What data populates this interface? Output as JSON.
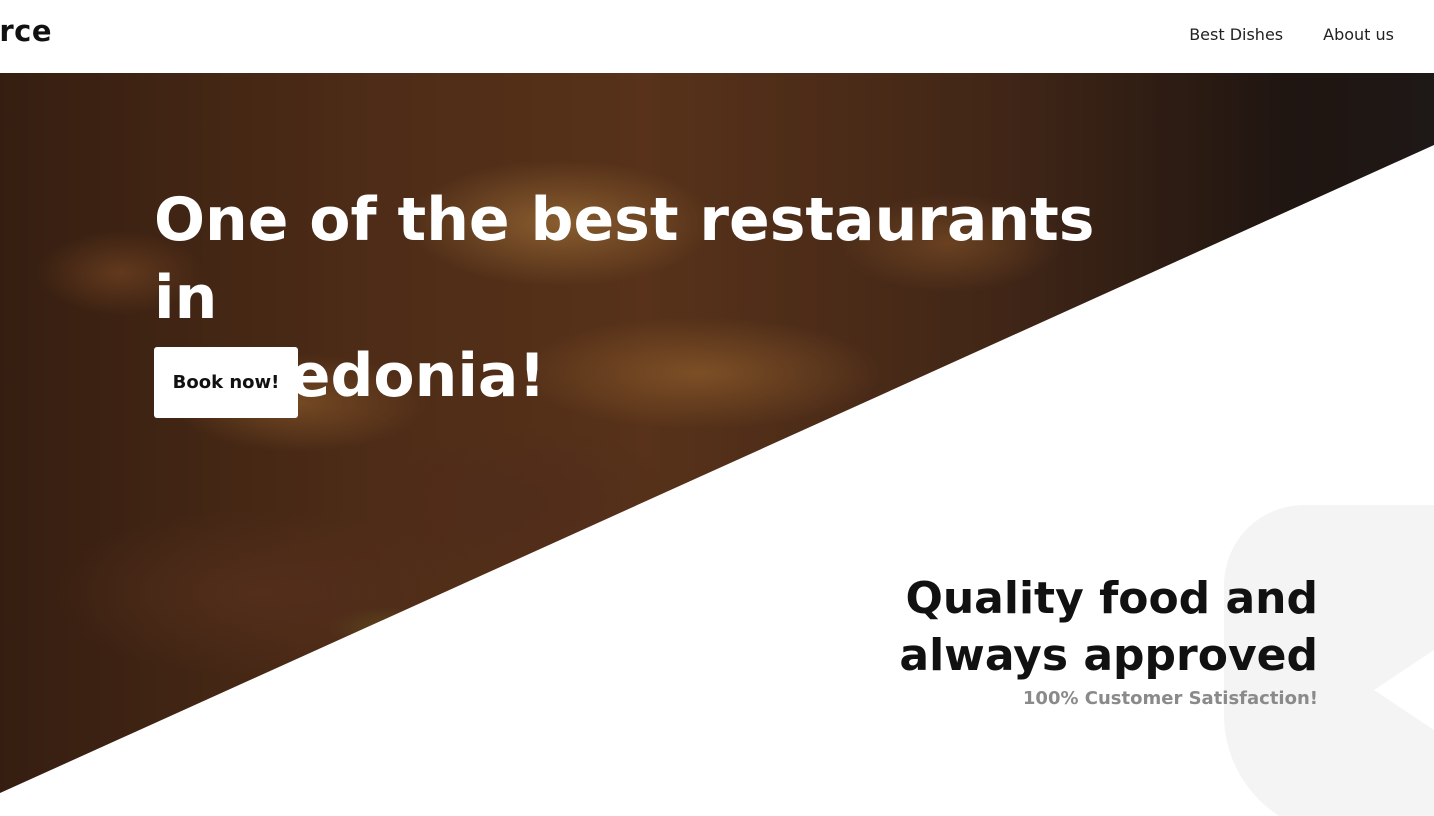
{
  "header": {
    "logo_text": "rce",
    "nav": [
      {
        "label": "Best Dishes"
      },
      {
        "label": "About us"
      }
    ]
  },
  "hero": {
    "title_line1": "One of the best restaurants in",
    "title_line2": "Macedonia!",
    "book_button": "Book now!"
  },
  "quality": {
    "heading_line1": "Quality food and",
    "heading_line2": "always approved",
    "subtext": "100% Customer Satisfaction!"
  },
  "colors": {
    "text_dark": "#111111",
    "subtext_gray": "#8a8a8a",
    "background": "#ffffff"
  }
}
